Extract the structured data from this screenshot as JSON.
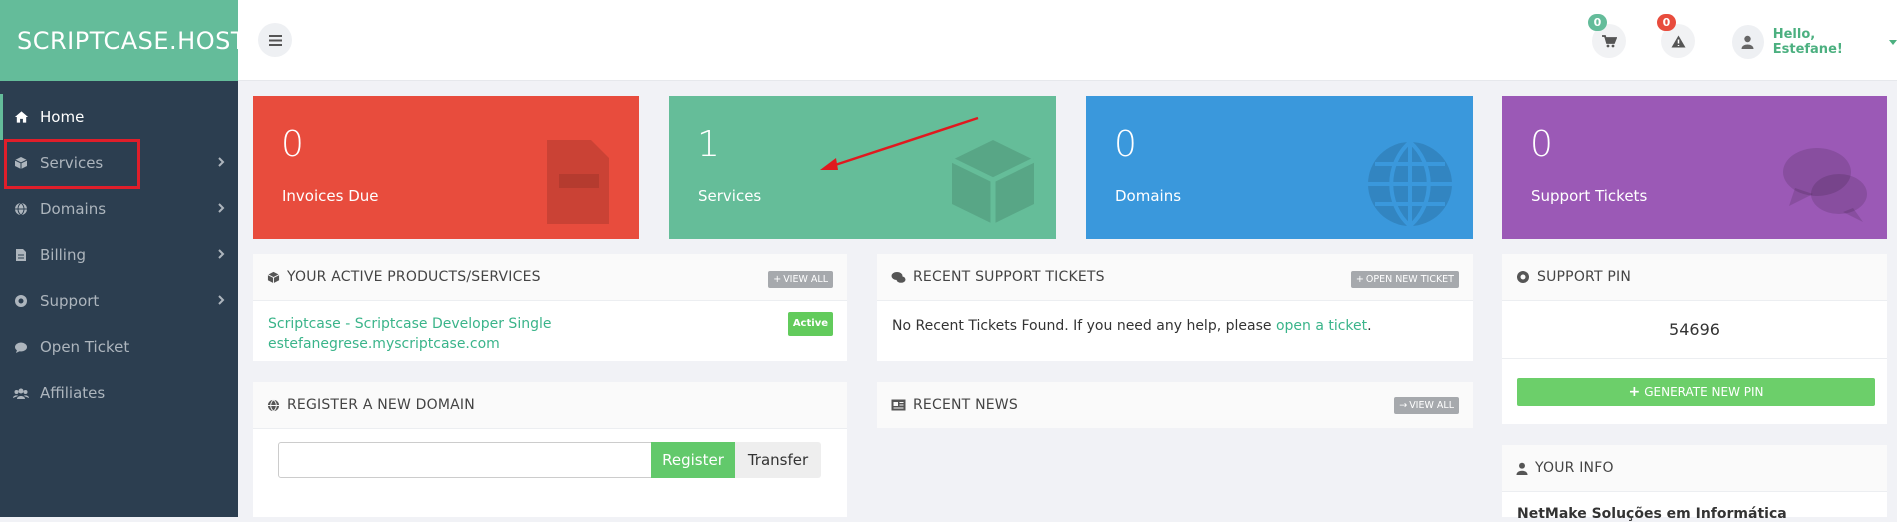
{
  "brand": "SCRIPTCASE.HOST",
  "sidebar": {
    "items": [
      {
        "label": "Home",
        "icon": "home-icon"
      },
      {
        "label": "Services",
        "icon": "cube-icon"
      },
      {
        "label": "Domains",
        "icon": "globe-icon"
      },
      {
        "label": "Billing",
        "icon": "document-icon"
      },
      {
        "label": "Support",
        "icon": "lifebuoy-icon"
      },
      {
        "label": "Open Ticket",
        "icon": "comment-icon"
      },
      {
        "label": "Affiliates",
        "icon": "users-icon"
      }
    ]
  },
  "topbar": {
    "cart_count": "0",
    "alerts_count": "0",
    "greeting": "Hello, Estefane!"
  },
  "tiles": [
    {
      "value": "0",
      "label": "Invoices Due",
      "color": "#e84c3d"
    },
    {
      "value": "1",
      "label": "Services",
      "color": "#65bd99"
    },
    {
      "value": "0",
      "label": "Domains",
      "color": "#3a98dc"
    },
    {
      "value": "0",
      "label": "Support Tickets",
      "color": "#9b59b6"
    }
  ],
  "products": {
    "title": "YOUR ACTIVE PRODUCTS/SERVICES",
    "view_all": "VIEW ALL",
    "service_name": "Scriptcase - Scriptcase Developer Single",
    "service_domain": "estefanegrese.myscriptcase.com",
    "status": "Active"
  },
  "tickets": {
    "title": "RECENT SUPPORT TICKETS",
    "open_new": "OPEN NEW TICKET",
    "empty_text": "No Recent Tickets Found. If you need any help, please ",
    "empty_link": "open a ticket",
    "empty_end": "."
  },
  "pin": {
    "title": "SUPPORT PIN",
    "value": "54696",
    "generate": "GENERATE NEW PIN"
  },
  "register": {
    "title": "REGISTER A NEW DOMAIN",
    "register_btn": "Register",
    "transfer_btn": "Transfer"
  },
  "news": {
    "title": "RECENT NEWS",
    "view_all": "VIEW ALL"
  },
  "info": {
    "title": "YOUR INFO",
    "company": "NetMake Soluções em Informática"
  },
  "colors": {
    "accent": "#64bc9a",
    "sidebar": "#2c3e50",
    "highlight": "#e01e2a"
  }
}
